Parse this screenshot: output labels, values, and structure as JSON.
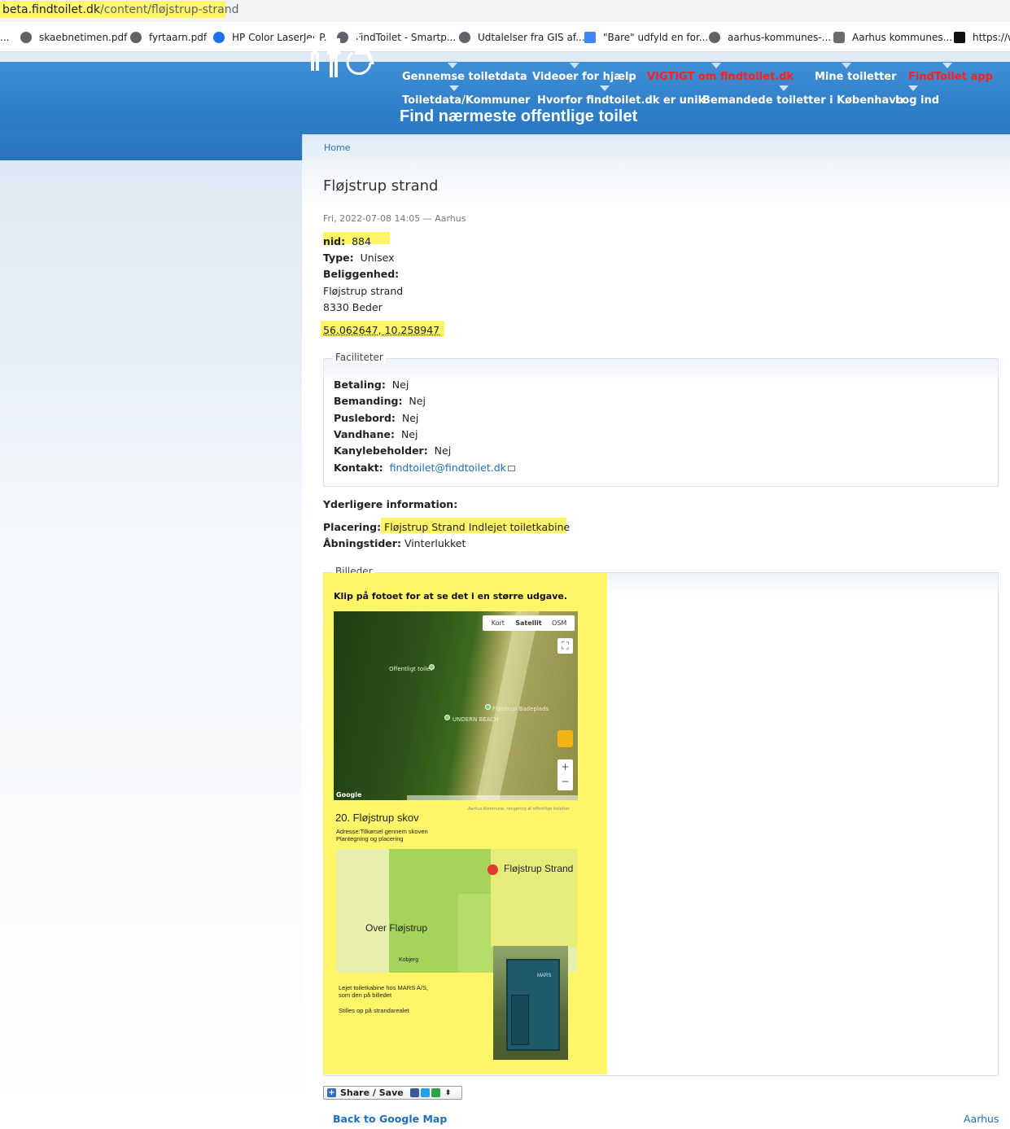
{
  "browser": {
    "url_host": "beta.findtoilet.dk",
    "url_path": "/content/fløjstrup-strand",
    "bookmarks": [
      {
        "label": "...",
        "icon": "ellipsis-icon"
      },
      {
        "label": "skaebnetimen.pdf",
        "icon": "globe-icon"
      },
      {
        "label": "fyrtaarn.pdf",
        "icon": "globe-icon"
      },
      {
        "label": "HP Color LaserJet P...",
        "icon": "hp-icon"
      },
      {
        "label": "FindToilet - Smartp...",
        "icon": "globe-icon"
      },
      {
        "label": "Udtalelser fra GIS af...",
        "icon": "globe-icon"
      },
      {
        "label": "\"Bare\" udfyld en for...",
        "icon": "doc-icon"
      },
      {
        "label": "aarhus-kommunes-...",
        "icon": "globe-icon"
      },
      {
        "label": "Aarhus kommunes...",
        "icon": "crest-icon"
      },
      {
        "label": "https://w",
        "icon": "dr-icon"
      }
    ]
  },
  "header": {
    "nav_row1": [
      {
        "label": "Gennemse toiletdata",
        "color": "#ffffff"
      },
      {
        "label": "Videoer for hjælp",
        "color": "#ffffff"
      },
      {
        "label": "VIGTIGT om findtoilet.dk",
        "color": "#ff1f1f"
      },
      {
        "label": "Mine toiletter",
        "color": "#ffffff"
      },
      {
        "label": "FindToilet app",
        "color": "#ff1f1f"
      }
    ],
    "nav_row2": [
      {
        "label": "Toiletdata/Kommuner"
      },
      {
        "label": "Hvorfor findtoilet.dk er unik"
      },
      {
        "label": "Bemandede toiletter i København"
      },
      {
        "label": "Log ind"
      }
    ],
    "title": "Find nærmeste offentlige toilet",
    "logo_icon": "toilet-people-wheelchair-icon"
  },
  "breadcrumb": {
    "home": "Home"
  },
  "node": {
    "title": "Fløjstrup strand",
    "meta": "Fri, 2022-07-08 14:05 — Aarhus",
    "nid_label": "nid:",
    "nid_value": "884",
    "type_label": "Type:",
    "type_value": "Unisex",
    "location_label": "Beliggenhed:",
    "address_line1": "Fløjstrup strand",
    "address_line2": "8330 Beder",
    "coordinates": "56.062647, 10.258947"
  },
  "facilities": {
    "legend": "Faciliteter",
    "rows": [
      {
        "label": "Betaling:",
        "value": "Nej"
      },
      {
        "label": "Bemanding:",
        "value": "Nej"
      },
      {
        "label": "Puslebord:",
        "value": "Nej"
      },
      {
        "label": "Vandhane:",
        "value": "Nej"
      },
      {
        "label": "Kanylebeholder:",
        "value": "Nej"
      }
    ],
    "contact_label": "Kontakt:",
    "contact_value": "findtoilet@findtoilet.dk"
  },
  "extra": {
    "heading": "Yderligere information:",
    "placement_label": "Placering:",
    "placement_value": "Fløjstrup Strand Indlejet toiletkabine",
    "hours_label": "Åbningstider:",
    "hours_value": "Vinterlukket"
  },
  "images": {
    "legend": "Billeder",
    "caption": "Klip på fotoet for at se det i en større udgave.",
    "sat_tabs": [
      "Kort",
      "Satellit",
      "OSM"
    ],
    "sat_active": "Satellit",
    "poi_labels": [
      "Offentligt toilet",
      "Fløjstrup Badeplads",
      "UNDERN BEACH"
    ],
    "google_label": "Google",
    "sat_footer": "Aarhus Kommune, rengøring af offentlige toiletter",
    "plan_title": "20. Fløjstrup skov",
    "plan_line1": "Adresse:Tilkørsel gennem skoven",
    "plan_line2": "Plantegning og placering",
    "map_label_strand": "Fløjstrup Strand",
    "map_label_over": "Over Fløjstrup",
    "map_label_kobjerg": "Kobjerg",
    "note_line1": "Lejet toiletkabine hos MARS A/S,",
    "note_line2": "som den på billedet",
    "note_line3": "Stilles op på strandarealet",
    "cabin_text": "MARS"
  },
  "share": {
    "label": "Share / Save"
  },
  "footer": {
    "back_link": "Back to Google Map",
    "city_link": "Aarhus"
  },
  "colors": {
    "highlight": "#fff568",
    "header_blue": "#2d7cc8",
    "link": "#1d6fb8",
    "red_nav": "#ff1f1f"
  }
}
